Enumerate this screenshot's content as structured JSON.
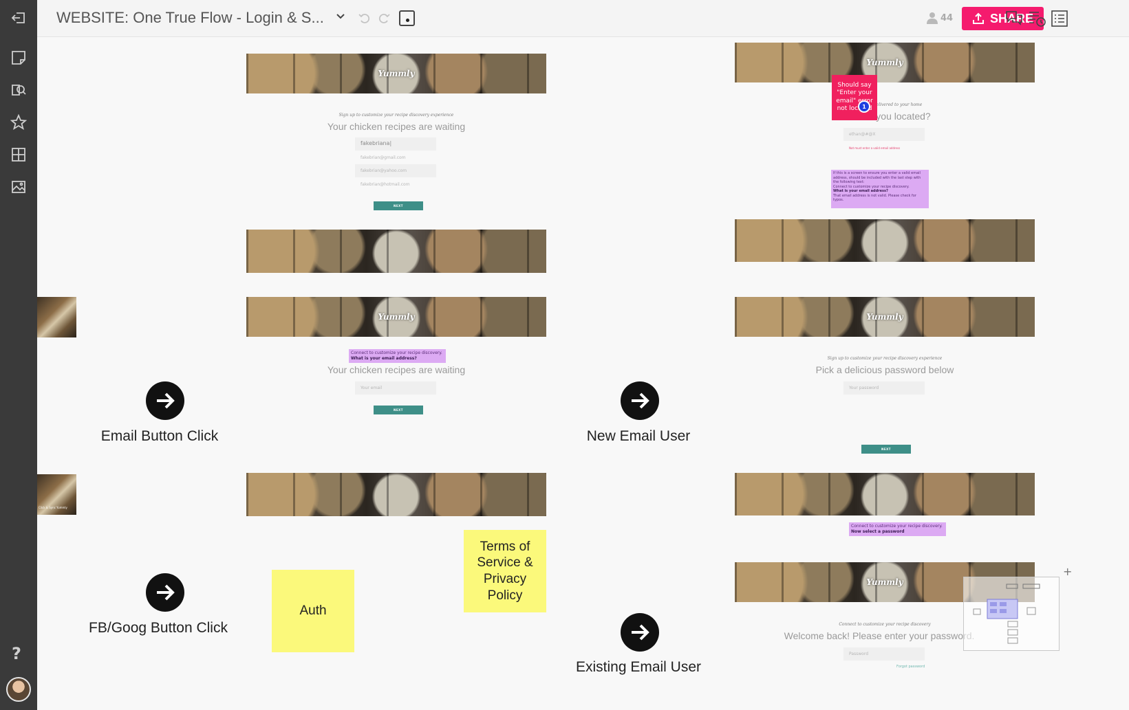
{
  "app": {
    "title": "WEBSITE: One True Flow - Login & S...",
    "user_count": "44",
    "share_label": "SHARE"
  },
  "sidebar": {
    "help_label": "?"
  },
  "screens": {
    "s1": {
      "logo": "Yummly",
      "subheading": "Sign up to customize your recipe discovery experience",
      "heading": "Your chicken recipes are waiting",
      "fields": [
        "fakebriana|",
        "fakebrian@gmail.com",
        "fakebrian@yahoo.com",
        "fakebrian@hotmail.com"
      ],
      "next": "NEXT"
    },
    "s2": {
      "logo": "Yummly",
      "comment_line1": "Connect to customize your recipe discovery.",
      "comment_line2": "What is your email address?",
      "heading": "Your chicken recipes are waiting",
      "field": "Your email",
      "next": "NEXT"
    },
    "s3": {
      "logo": "Yummly",
      "subheading": "delivered to your home",
      "heading": "you located?",
      "field": "ethan@#@X",
      "error": "Not must enter a valid email address",
      "pink_note": "Should say \"Enter your email\" error not located",
      "comment_badge": "1",
      "comment_body": "If this is a screen to ensure you enter a valid email address, should be included with the last step with the following text:",
      "comment_line2": "Connect to customize your recipe discovery.",
      "comment_bold": "What is your email address?",
      "comment_line3": "That email address is not valid. Please check for typos."
    },
    "s4": {
      "logo": "Yummly",
      "subheading": "Sign up to customize your recipe discovery experience",
      "heading": "Pick a delicious password below",
      "field": "Your password",
      "next": "NEXT"
    },
    "s5": {
      "comment_line1": "Connect to customize your recipe discovery.",
      "comment_line2": "Now select a password"
    },
    "s6": {
      "logo": "Yummly",
      "subheading": "Connect to customize your recipe discovery",
      "heading": "Welcome back! Please enter your password.",
      "field": "Password",
      "link": "Forgot password"
    },
    "thumb2_caption": "Click & Sync Yummly"
  },
  "flow": {
    "email_click": "Email Button Click",
    "new_user": "New Email User",
    "fb_goog": "FB/Goog Button Click",
    "existing_user": "Existing Email User"
  },
  "stickies": {
    "auth": "Auth",
    "terms": "Terms of Service & Privacy Policy"
  },
  "colors": {
    "sidebar": "#3a3a3a",
    "share": "#f51b6e",
    "sticky": "#fbf97b",
    "comment": "#dcaaf3",
    "button_teal": "#3e8f88",
    "error_pink": "#f0205e"
  }
}
